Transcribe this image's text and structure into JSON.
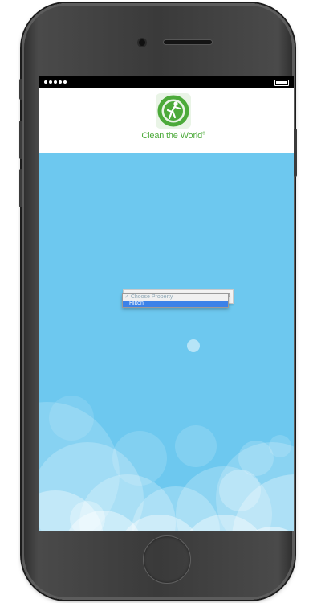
{
  "app": {
    "logo_text": "Clean the World",
    "logo_trademark": "®",
    "logo_color": "#4caa3a",
    "background_color": "#6dc8ef"
  },
  "status_bar": {
    "signal_dots": 5,
    "battery_icon": "battery-icon"
  },
  "property_select": {
    "selected_label": "Choose Property",
    "options": [
      {
        "label": "Choose Property",
        "checked": true
      },
      {
        "label": "Hilton",
        "highlighted": true
      }
    ],
    "highlight_color": "#3c82e8"
  }
}
